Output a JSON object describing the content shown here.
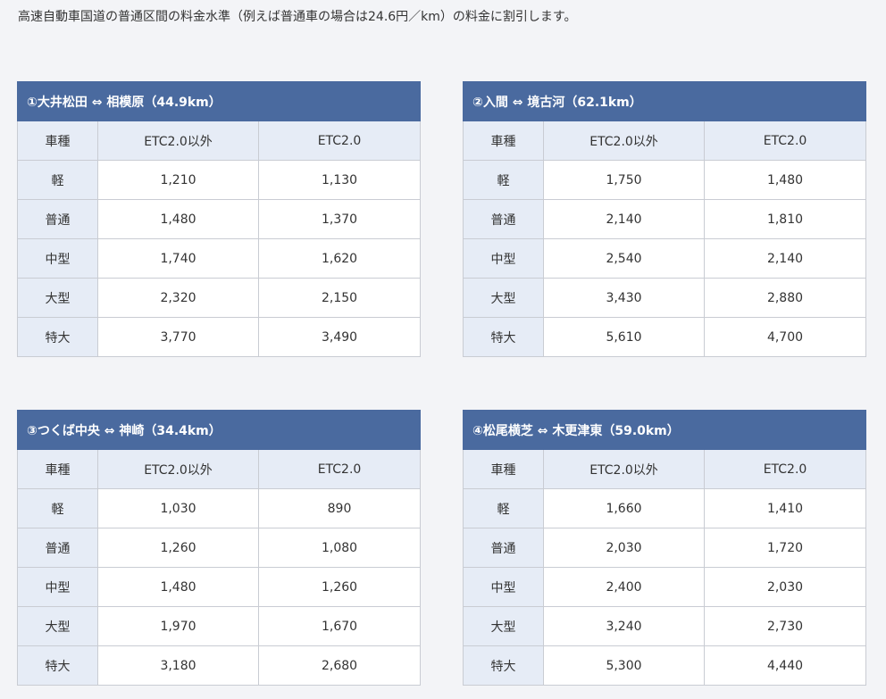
{
  "intro_text": "高速自動車国道の普通区間の料金水準（例えば普通車の場合は24.6円／km）の料金に割引します。",
  "columns": {
    "vehicle": "車種",
    "non_etc2": "ETC2.0以外",
    "etc2": "ETC2.0"
  },
  "tables": [
    {
      "title": "①大井松田 ⇔ 相模原（44.9km）",
      "rows": [
        {
          "vehicle": "軽",
          "non_etc2": "1,210",
          "etc2": "1,130"
        },
        {
          "vehicle": "普通",
          "non_etc2": "1,480",
          "etc2": "1,370"
        },
        {
          "vehicle": "中型",
          "non_etc2": "1,740",
          "etc2": "1,620"
        },
        {
          "vehicle": "大型",
          "non_etc2": "2,320",
          "etc2": "2,150"
        },
        {
          "vehicle": "特大",
          "non_etc2": "3,770",
          "etc2": "3,490"
        }
      ]
    },
    {
      "title": "②入間 ⇔ 境古河（62.1km）",
      "rows": [
        {
          "vehicle": "軽",
          "non_etc2": "1,750",
          "etc2": "1,480"
        },
        {
          "vehicle": "普通",
          "non_etc2": "2,140",
          "etc2": "1,810"
        },
        {
          "vehicle": "中型",
          "non_etc2": "2,540",
          "etc2": "2,140"
        },
        {
          "vehicle": "大型",
          "non_etc2": "3,430",
          "etc2": "2,880"
        },
        {
          "vehicle": "特大",
          "non_etc2": "5,610",
          "etc2": "4,700"
        }
      ]
    },
    {
      "title": "③つくば中央 ⇔ 神崎（34.4km）",
      "rows": [
        {
          "vehicle": "軽",
          "non_etc2": "1,030",
          "etc2": "890"
        },
        {
          "vehicle": "普通",
          "non_etc2": "1,260",
          "etc2": "1,080"
        },
        {
          "vehicle": "中型",
          "non_etc2": "1,480",
          "etc2": "1,260"
        },
        {
          "vehicle": "大型",
          "non_etc2": "1,970",
          "etc2": "1,670"
        },
        {
          "vehicle": "特大",
          "non_etc2": "3,180",
          "etc2": "2,680"
        }
      ]
    },
    {
      "title": "④松尾横芝 ⇔ 木更津東（59.0km）",
      "rows": [
        {
          "vehicle": "軽",
          "non_etc2": "1,660",
          "etc2": "1,410"
        },
        {
          "vehicle": "普通",
          "non_etc2": "2,030",
          "etc2": "1,720"
        },
        {
          "vehicle": "中型",
          "non_etc2": "2,400",
          "etc2": "2,030"
        },
        {
          "vehicle": "大型",
          "non_etc2": "3,240",
          "etc2": "2,730"
        },
        {
          "vehicle": "特大",
          "non_etc2": "5,300",
          "etc2": "4,440"
        }
      ]
    }
  ]
}
